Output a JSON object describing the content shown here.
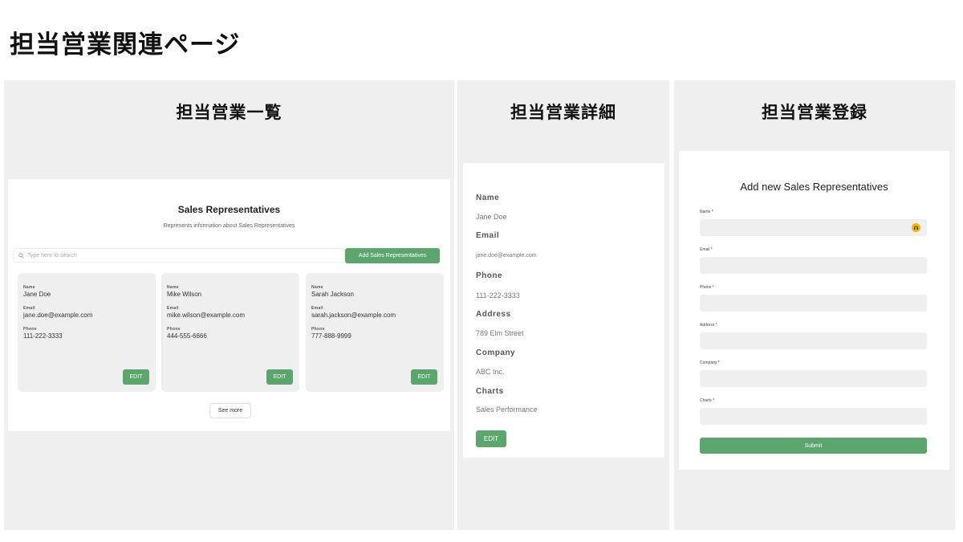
{
  "page_title": "担当営業関連ページ",
  "colors": {
    "accent": "#5aa66d",
    "panel_bg": "#eeefee",
    "input_bg": "#efefef"
  },
  "list_panel": {
    "heading": "担当営業一覧",
    "title": "Sales Representatives",
    "subtitle": "Represents information about Sales Representatives",
    "search_placeholder": "Type here to search",
    "search_icon": "search-icon",
    "add_button": "Add Sales Representatives",
    "field_labels": {
      "name": "Name",
      "email": "Email",
      "phone": "Phone"
    },
    "edit_label": "EDIT",
    "see_more": "See more",
    "reps": [
      {
        "name": "Jane Doe",
        "email": "jane.doe@example.com",
        "phone": "111-222-3333"
      },
      {
        "name": "Mike Wilson",
        "email": "mike.wilson@example.com",
        "phone": "444-555-6666"
      },
      {
        "name": "Sarah Jackson",
        "email": "sarah.jackson@example.com",
        "phone": "777-888-9999"
      }
    ]
  },
  "detail_panel": {
    "heading": "担当営業詳細",
    "fields": [
      {
        "label": "Name",
        "value": "Jane Doe"
      },
      {
        "label": "Email",
        "value": "jane.doe@example.com"
      },
      {
        "label": "Phone",
        "value": "111-222-3333"
      },
      {
        "label": "Address",
        "value": "789 Elm Street"
      },
      {
        "label": "Company",
        "value": "ABC Inc."
      },
      {
        "label": "Charts",
        "value": "Sales Performance"
      }
    ],
    "edit_label": "EDIT"
  },
  "register_panel": {
    "heading": "担当営業登録",
    "title": "Add new Sales Representatives",
    "fields": [
      {
        "label": "Name *",
        "value": ""
      },
      {
        "label": "Email *",
        "value": ""
      },
      {
        "label": "Phone *",
        "value": ""
      },
      {
        "label": "Address *",
        "value": ""
      },
      {
        "label": "Company *",
        "value": ""
      },
      {
        "label": "Charts *",
        "value": ""
      }
    ],
    "name_field_icon": "avatar-icon",
    "submit_label": "Submit"
  }
}
